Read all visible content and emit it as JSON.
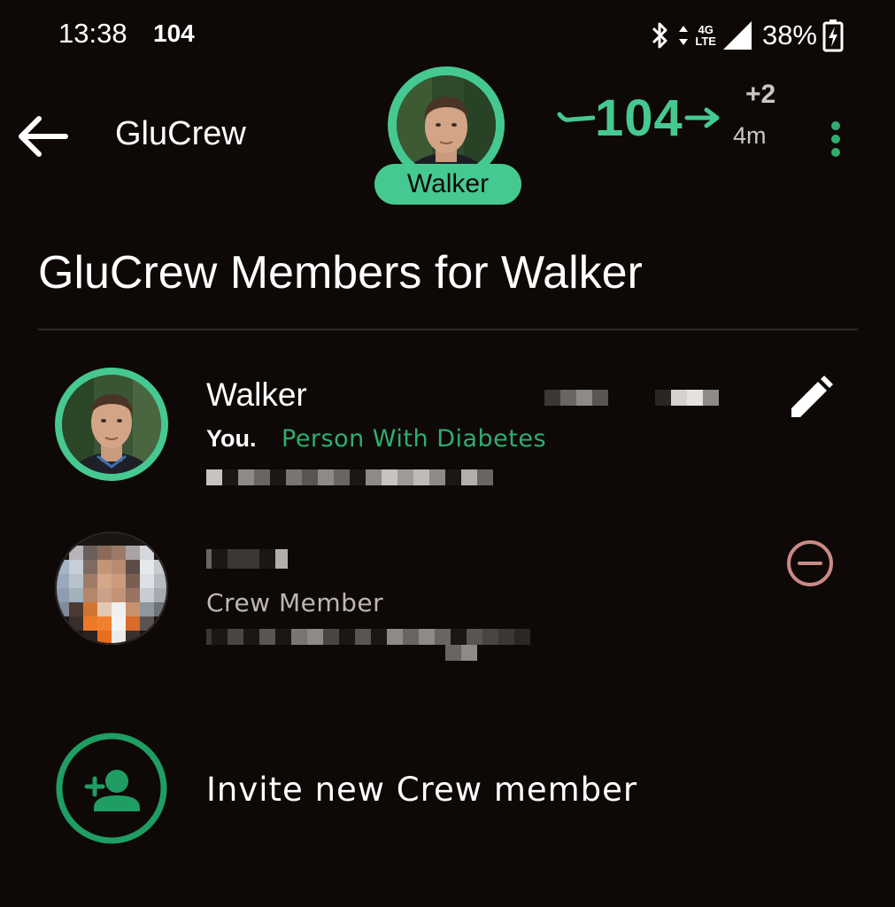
{
  "status_bar": {
    "time": "13:38",
    "glucose": "104",
    "network": "4G",
    "network_sub": "LTE",
    "battery": "38%"
  },
  "app_bar": {
    "title": "GluCrew",
    "profile_name": "Walker",
    "reading": "104",
    "delta": "+2",
    "age": "4m"
  },
  "section": {
    "title": "GluCrew Members for Walker"
  },
  "members": [
    {
      "name": "Walker",
      "you_label": "You.",
      "role": "Person With Diabetes"
    },
    {
      "name": "",
      "role": "Crew Member"
    }
  ],
  "invite": {
    "label": "Invite new Crew member"
  },
  "colors": {
    "accent": "#46c891",
    "accent_text": "#2fae6e",
    "remove": "#c98a86",
    "background": "#0e0907"
  }
}
